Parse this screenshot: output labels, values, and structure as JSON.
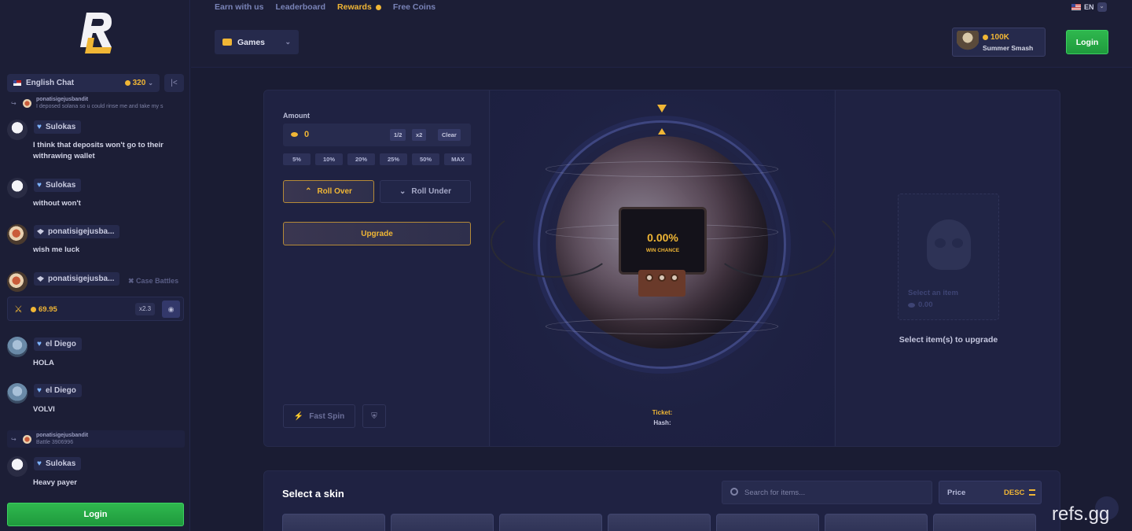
{
  "nav": {
    "links": [
      "Earn with us",
      "Leaderboard",
      "Rewards",
      "Free Coins"
    ],
    "language": "EN",
    "games_label": "Games",
    "promo_value": "100K",
    "promo_name": "Summer Smash",
    "login_label": "Login"
  },
  "sidebar": {
    "chat_room": "English Chat",
    "online_count": "320",
    "messages": [
      {
        "user": "ponatisigejusbandit",
        "text": "I deposed solana so u could rinse me and take my s",
        "kind": "reply-preview"
      },
      {
        "user": "Sulokas",
        "text": "I think that deposits won't go to their withrawing wallet"
      },
      {
        "user": "Sulokas",
        "text": "without won't"
      },
      {
        "user": "ponatisigejusba...",
        "text": "wish me luck"
      },
      {
        "user": "ponatisigejusba...",
        "tag": "Case Battles",
        "battle_amount": "69.95",
        "battle_mult": "x2.3"
      },
      {
        "user": "el Diego",
        "text": "HOLA"
      },
      {
        "user": "el Diego",
        "text": "VOLVI"
      },
      {
        "user": "ponatisigejusbandit",
        "text": "Battle 3906996",
        "kind": "reply-preview"
      },
      {
        "user": "Sulokas",
        "text": "Heavy payer"
      }
    ],
    "login_label": "Login"
  },
  "upgrade": {
    "amount_label": "Amount",
    "amount_value": "0",
    "half_label": "1/2",
    "double_label": "x2",
    "clear_label": "Clear",
    "percent_options": [
      "5%",
      "10%",
      "20%",
      "25%",
      "50%",
      "MAX"
    ],
    "roll_over_label": "Roll Over",
    "roll_under_label": "Roll Under",
    "upgrade_label": "Upgrade",
    "fast_spin_label": "Fast Spin",
    "win_chance_value": "0.00%",
    "win_chance_label": "WIN CHANCE",
    "ticket_label": "Ticket:",
    "hash_label": "Hash:",
    "target_prompt": "Select an item",
    "target_value": "0.00",
    "select_items_label": "Select item(s) to upgrade"
  },
  "skins": {
    "title": "Select a skin",
    "search_placeholder": "Search for items...",
    "sort_label": "Price",
    "sort_dir": "DESC"
  },
  "watermark": "refs.gg",
  "colors": {
    "accent": "#f0b635",
    "login_green": "#1f9a3d",
    "background": "#1a1c33"
  }
}
